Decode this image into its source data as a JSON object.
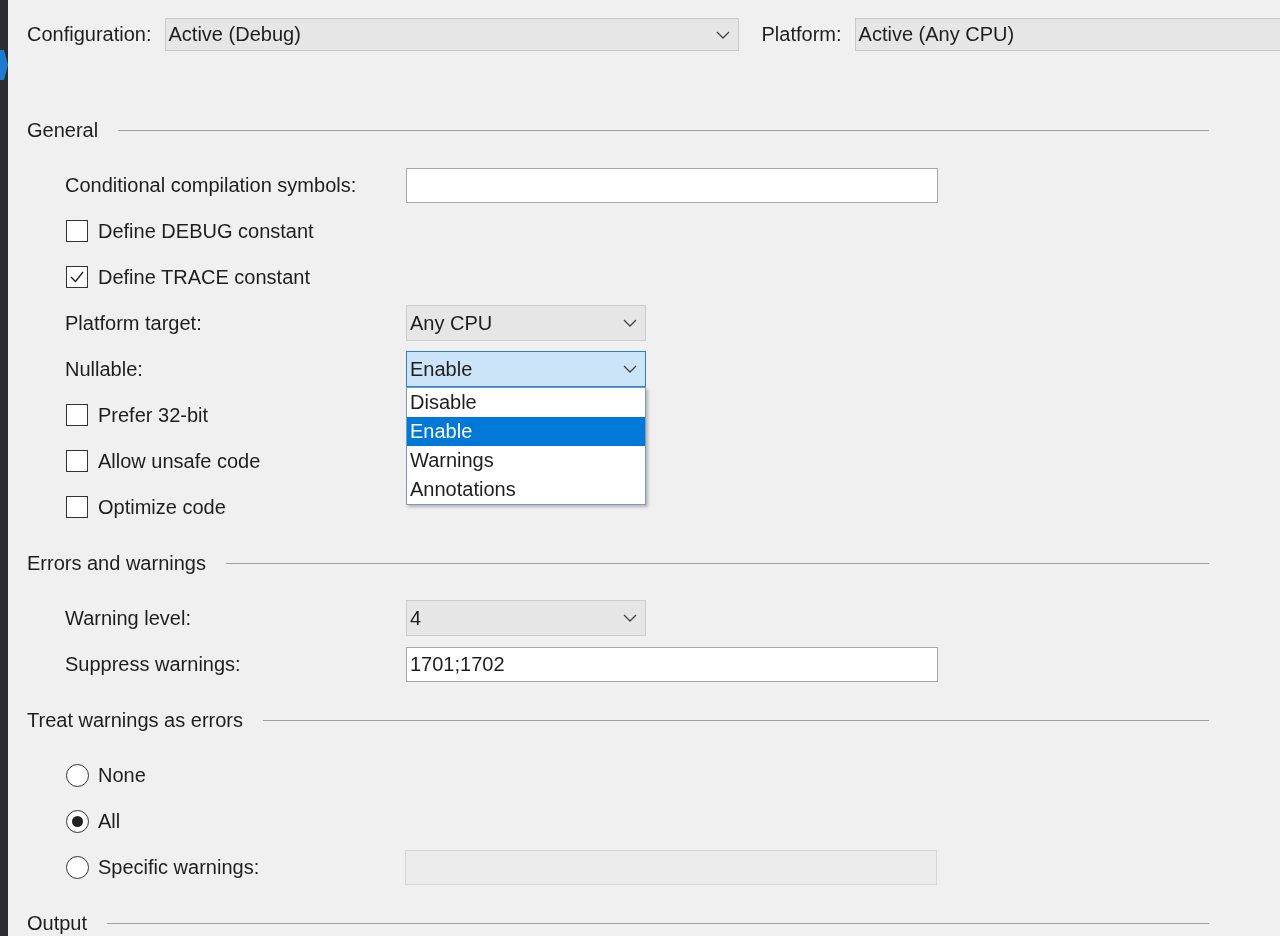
{
  "configuration": {
    "label": "Configuration:",
    "value": "Active (Debug)"
  },
  "platform": {
    "label": "Platform:",
    "value": "Active (Any CPU)"
  },
  "sections": [
    {
      "title": "General",
      "items": [
        {
          "kind": "text",
          "label": "Conditional compilation symbols:"
        },
        {
          "kind": "checkbox",
          "label": "Define DEBUG constant",
          "checked": false
        },
        {
          "kind": "checkbox",
          "label": "Define TRACE constant",
          "checked": true
        },
        {
          "kind": "select",
          "label": "Platform target:",
          "value": "Any CPU",
          "expanded": false
        },
        {
          "kind": "select",
          "label": "Nullable:",
          "value": "Enable",
          "expanded": true,
          "options": [
            {
              "label": "Disable",
              "selected": false
            },
            {
              "label": "Enable",
              "selected": true
            },
            {
              "label": "Warnings",
              "selected": false
            },
            {
              "label": "Annotations",
              "selected": false
            }
          ]
        },
        {
          "kind": "checkbox",
          "label": "Prefer 32-bit",
          "checked": false
        },
        {
          "kind": "checkbox",
          "label": "Allow unsafe code",
          "checked": false
        },
        {
          "kind": "checkbox",
          "label": "Optimize code",
          "checked": false
        }
      ]
    },
    {
      "title": "Errors and warnings",
      "items": [
        {
          "kind": "select",
          "label": "Warning level:",
          "value": "4",
          "expanded": false
        },
        {
          "kind": "text",
          "label": "Suppress warnings:",
          "value": "1701;1702"
        }
      ]
    },
    {
      "title": "Treat warnings as errors",
      "items": [
        {
          "kind": "radio",
          "label": "None",
          "selected": false
        },
        {
          "kind": "radio",
          "label": "All",
          "selected": true
        },
        {
          "kind": "radio",
          "label": "Specific warnings:",
          "selected": false,
          "field_disabled": true
        }
      ]
    },
    {
      "title": "Output"
    }
  ]
}
